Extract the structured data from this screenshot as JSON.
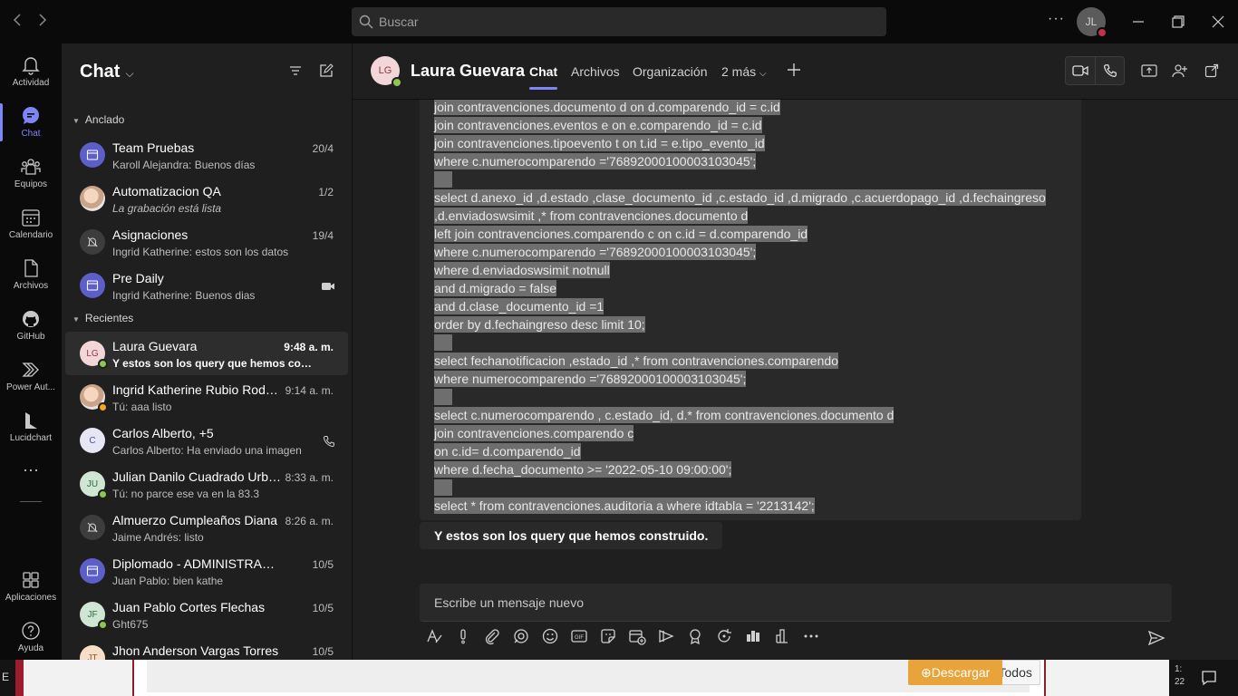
{
  "titlebar": {
    "search_placeholder": "Buscar",
    "more": "···",
    "avatar": "JL"
  },
  "rail": [
    {
      "label": "Actividad",
      "icon": "bell-icon"
    },
    {
      "label": "Chat",
      "icon": "chat-icon"
    },
    {
      "label": "Equipos",
      "icon": "teams-icon"
    },
    {
      "label": "Calendario",
      "icon": "calendar-icon"
    },
    {
      "label": "Archivos",
      "icon": "file-icon"
    },
    {
      "label": "GitHub",
      "icon": "github-icon"
    },
    {
      "label": "Power Aut...",
      "icon": "power-automate-icon"
    },
    {
      "label": "Lucidchart",
      "icon": "lucidchart-icon"
    },
    {
      "label": "···",
      "icon": "more-apps-icon"
    },
    {
      "label": "Aplicaciones",
      "icon": "apps-icon"
    },
    {
      "label": "Ayuda",
      "icon": "help-icon"
    }
  ],
  "chatlist": {
    "title": "Chat",
    "pinned_label": "Anclado",
    "recent_label": "Recientes",
    "pinned": [
      {
        "name": "Team Pruebas",
        "preview": "Karoll Alejandra: Buenos días",
        "time": "20/4"
      },
      {
        "name": "Automatizacion QA",
        "preview": "La grabación está lista",
        "time": "1/2"
      },
      {
        "name": "Asignaciones",
        "preview": "Ingrid Katherine: estos son los datos",
        "time": "19/4"
      },
      {
        "name": "Pre Daily",
        "preview": "Ingrid Katherine: Buenos dias",
        "time": ""
      }
    ],
    "recent": [
      {
        "name": "Laura Guevara",
        "initials": "LG",
        "preview": "Y estos son los query que hemos construido.",
        "time": "9:48 a. m."
      },
      {
        "name": "Ingrid Katherine Rubio Rodríguez",
        "preview": "Tú: aaa listo",
        "time": "9:14 a. m."
      },
      {
        "name": "Carlos Alberto, +5",
        "initials": "C",
        "preview": "Carlos Alberto: Ha enviado una imagen",
        "time": ""
      },
      {
        "name": "Julian Danilo Cuadrado Urbano",
        "initials": "JU",
        "preview": "Tú: no parce ese va en la 83.3",
        "time": "8:33 a. m."
      },
      {
        "name": "Almuerzo Cumpleaños Diana",
        "preview": "Jaime Andrés: listo",
        "time": "8:26 a. m."
      },
      {
        "name": "Diplomado - ADMINISTRACIÓN DE BASES",
        "preview": "Juan Pablo: bien kathe",
        "time": "10/5"
      },
      {
        "name": "Juan Pablo Cortes Flechas",
        "initials": "JF",
        "preview": "Ght675",
        "time": "10/5"
      },
      {
        "name": "Jhon Anderson Vargas Torres",
        "initials": "JT",
        "preview": "",
        "time": "10/5"
      }
    ]
  },
  "main": {
    "contact_initials": "LG",
    "contact_name": "Laura Guevara",
    "tabs": [
      "Chat",
      "Archivos",
      "Organización",
      "2 más"
    ],
    "code_lines": [
      "join contravenciones.documento d on d.comparendo_id = c.id",
      "join contravenciones.eventos e on e.comparendo_id = c.id",
      "join contravenciones.tipoevento t on t.id = e.tipo_evento_id",
      "where c.numerocomparendo ='76892000100003103045';",
      " ",
      "select d.anexo_id ,d.estado ,clase_documento_id ,c.estado_id ,d.migrado ,c.acuerdopago_id ,d.fechaingreso",
      ",d.enviadoswsimit ,* from contravenciones.documento d",
      "left join contravenciones.comparendo c on c.id = d.comparendo_id",
      "where c.numerocomparendo ='76892000100003103045';",
      "where d.enviadoswsimit notnull",
      "and d.migrado = false",
      "and d.clase_documento_id =1",
      "order by d.fechaingreso desc limit 10;",
      " ",
      "select fechanotificacion ,estado_id ,* from contravenciones.comparendo",
      "where numerocomparendo ='76892000100003103045';",
      " ",
      "select c.numerocomparendo , c.estado_id, d.* from contravenciones.documento d",
      "join contravenciones.comparendo c",
      "on c.id= d.comparendo_id",
      "where d.fecha_documento >= '2022-05-10 09:00:00';",
      " ",
      "select * from contravenciones.auditoria a where idtabla = '2213142';"
    ],
    "message": "Y estos son los query que hemos construido.",
    "compose_placeholder": "Escribe un mensaje nuevo"
  },
  "bottom": {
    "select_all": "Seleccionar Todos",
    "download": "Descargar",
    "left_fragment": "E",
    "right_fragment_1": "1:",
    "right_fragment_2": "22"
  },
  "colors": {
    "accent": "#7f85f5",
    "available": "#92c353",
    "away": "#f8a61e",
    "download_btn": "#e8a33b"
  }
}
